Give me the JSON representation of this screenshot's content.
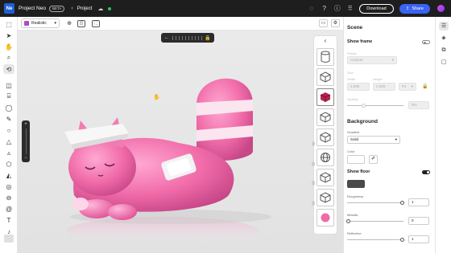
{
  "topbar": {
    "logo": "Ne",
    "project_name": "Project Neo",
    "beta_badge": "BETA",
    "breadcrumb": "Project",
    "download_label": "Download",
    "share_label": "Share",
    "icons": [
      "chevron-left-icon",
      "cloud-icon",
      "status-dot",
      "notifications-icon",
      "help-icon",
      "info-icon",
      "apps-grid-icon"
    ]
  },
  "subbar": {
    "render_mode": "Realistic",
    "icons": [
      "camera-orbit-icon",
      "view-toggle-icon",
      "frame-icon",
      "layout-icon",
      "settings-icon"
    ]
  },
  "left_tools": [
    "select",
    "arrow",
    "pan-hand",
    "zoom",
    "orbit",
    "cube",
    "cylinder",
    "sphere",
    "pen",
    "circle",
    "cone",
    "triangle",
    "pyramid",
    "cone-2",
    "torus",
    "capsule",
    "spiral",
    "triangle-2",
    "text",
    "bell"
  ],
  "viewport": {
    "floater_icons": [
      "arrow-left",
      "pause",
      "arrow-right"
    ],
    "zoom_rail": [
      "plus",
      "minus"
    ]
  },
  "assets": {
    "collapse_icon": "chevron-left-icon",
    "thumbs": [
      "cylinder",
      "cube",
      "red-cube",
      "cube-2",
      "cube-3",
      "mesh-sphere",
      "cube-4",
      "cube-5",
      "pink-sphere"
    ]
  },
  "scene": {
    "title": "Scene",
    "show_frame_label": "Show frame",
    "preset_label": "Preset",
    "preset_value": "Custom",
    "size_label": "Size",
    "width_label": "Width",
    "width_value": "2,000",
    "height_label": "Height",
    "height_value": "2,000",
    "unit_value": "Px",
    "opacity_label": "Opacity",
    "opacity_value": "0%",
    "background_title": "Background",
    "gradient_label": "Gradient",
    "gradient_value": "Solid",
    "color_label": "Color",
    "show_floor_label": "Show floor",
    "roughness_label": "Roughness",
    "roughness_value": "1",
    "metallic_label": "Metallic",
    "metallic_value": "0",
    "reflective_label": "Reflective",
    "reflective_value": "1",
    "show_frame_on": false,
    "show_floor_on": true,
    "floor_color": "#4a4a4a"
  },
  "colors": {
    "accent": "#3b63f3",
    "model_pink": "#f06aa8"
  }
}
